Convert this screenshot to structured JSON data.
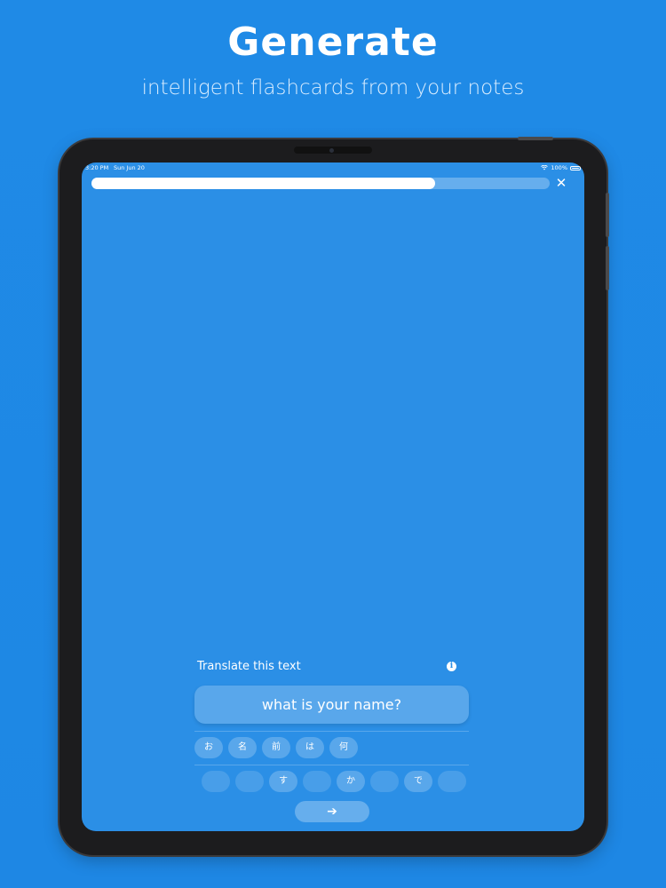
{
  "hero": {
    "title": "Generate",
    "subtitle": "intelligent flashcards from your notes"
  },
  "status_bar": {
    "time": "3:20 PM",
    "date": "Sun Jun 20",
    "battery": "100%",
    "wifi_icon": "wifi-icon",
    "battery_icon": "battery-icon"
  },
  "progress": {
    "fraction": 0.75
  },
  "close": {
    "label": "✕",
    "icon": "close-icon"
  },
  "exercise": {
    "prompt": "Translate this text",
    "info_icon": "i",
    "source_text": "what is your name?",
    "answer_chips": [
      "お",
      "名",
      "前",
      "は",
      "何"
    ],
    "word_bank": [
      "",
      "",
      "す",
      "",
      "か",
      "",
      "で",
      ""
    ],
    "next_label": "➔"
  },
  "colors": {
    "background": "#1e88e5",
    "screen": "#2b8fe6",
    "text": "#ffffff"
  }
}
